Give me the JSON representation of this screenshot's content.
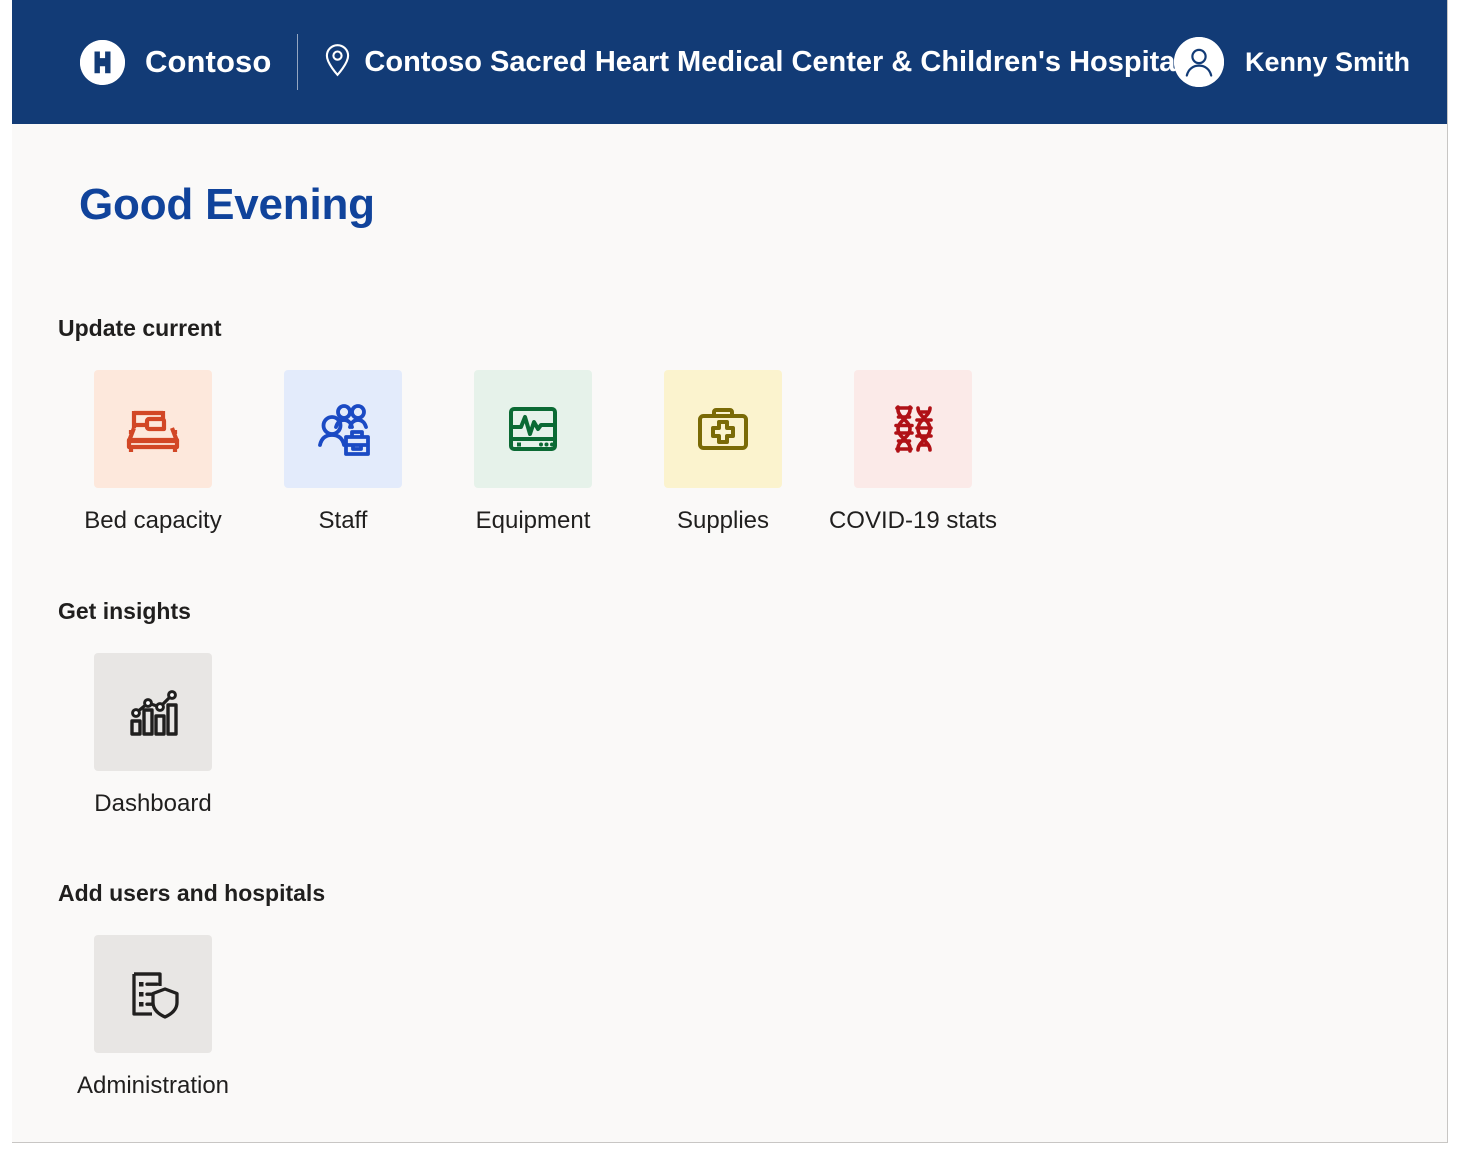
{
  "header": {
    "logo_icon": "hospital-h-logo-icon",
    "brand": "Contoso",
    "location_icon": "location-pin-icon",
    "facility": "Contoso Sacred Heart Medical Center & Children's Hospital",
    "avatar_icon": "user-avatar-icon",
    "user": "Kenny Smith",
    "bar_color": "#123B76"
  },
  "main": {
    "greeting": "Good Evening",
    "greeting_color": "#10439B",
    "sections": [
      {
        "title": "Update current",
        "tiles": [
          {
            "label": "Bed capacity",
            "icon": "bed-icon",
            "bg": "#FDE8DC",
            "fg": "#D24726"
          },
          {
            "label": "Staff",
            "icon": "staff-people-icon",
            "bg": "#E3EBFB",
            "fg": "#1B4AC4"
          },
          {
            "label": "Equipment",
            "icon": "ecg-monitor-icon",
            "bg": "#E6F2EA",
            "fg": "#0B6A34"
          },
          {
            "label": "Supplies",
            "icon": "first-aid-kit-icon",
            "bg": "#FBF3CE",
            "fg": "#7A6A06"
          },
          {
            "label": "COVID-19 stats",
            "icon": "dna-helix-icon",
            "bg": "#FBEAE8",
            "fg": "#B01116"
          }
        ]
      },
      {
        "title": "Get insights",
        "tiles": [
          {
            "label": "Dashboard",
            "icon": "bar-chart-trend-icon",
            "bg": "#E8E6E4",
            "fg": "#201F1E"
          }
        ]
      },
      {
        "title": "Add users and hospitals",
        "tiles": [
          {
            "label": "Administration",
            "icon": "list-shield-icon",
            "bg": "#E8E6E4",
            "fg": "#201F1E"
          }
        ]
      }
    ]
  }
}
